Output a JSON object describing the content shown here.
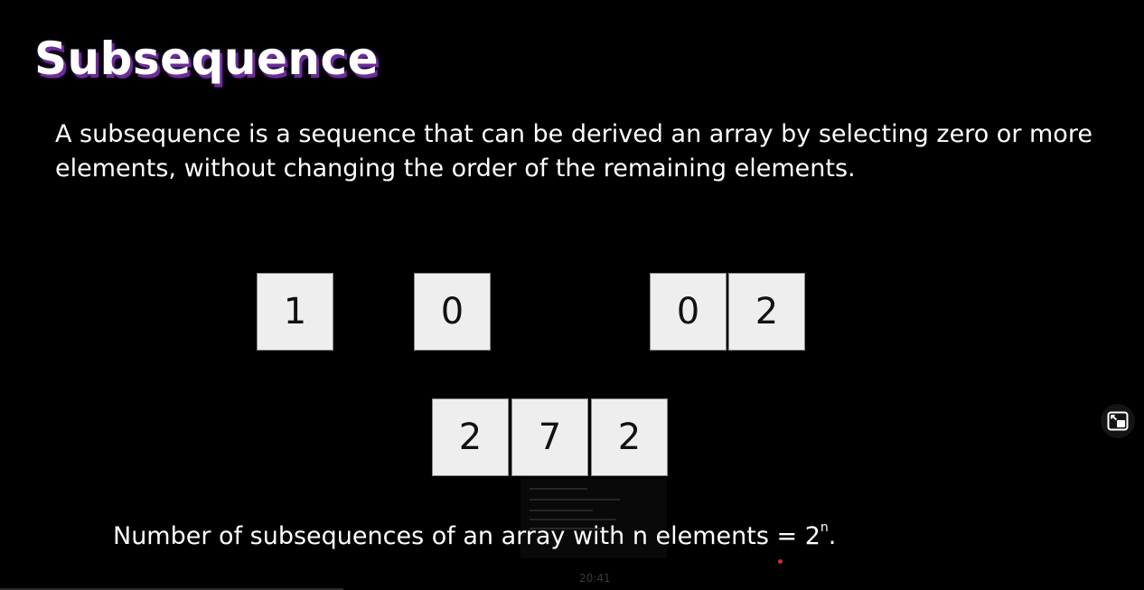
{
  "slide": {
    "title": "Subsequence",
    "definition_line1": "A subsequence is a sequence that can be derived an array by selecting zero or more",
    "definition_line2": "elements, without changing the order of the remaining elements.",
    "examples": {
      "group1": [
        "1"
      ],
      "group2": [
        "0"
      ],
      "group3": [
        "0",
        "2"
      ],
      "group4": [
        "2",
        "7",
        "2"
      ]
    },
    "formula_text": "Number of subsequences of an array with n elements = 2",
    "formula_exponent": "n",
    "formula_end": "."
  },
  "video_overlay": {
    "timestamp": "20:41",
    "pip_icon": "picture-in-picture-icon",
    "accent_color": "#d22a3a"
  },
  "colors": {
    "background": "#000000",
    "text": "#ffffff",
    "title_shadow": "#6b2c9a",
    "cell_fill": "#eeeeee",
    "cell_text": "#111111"
  }
}
